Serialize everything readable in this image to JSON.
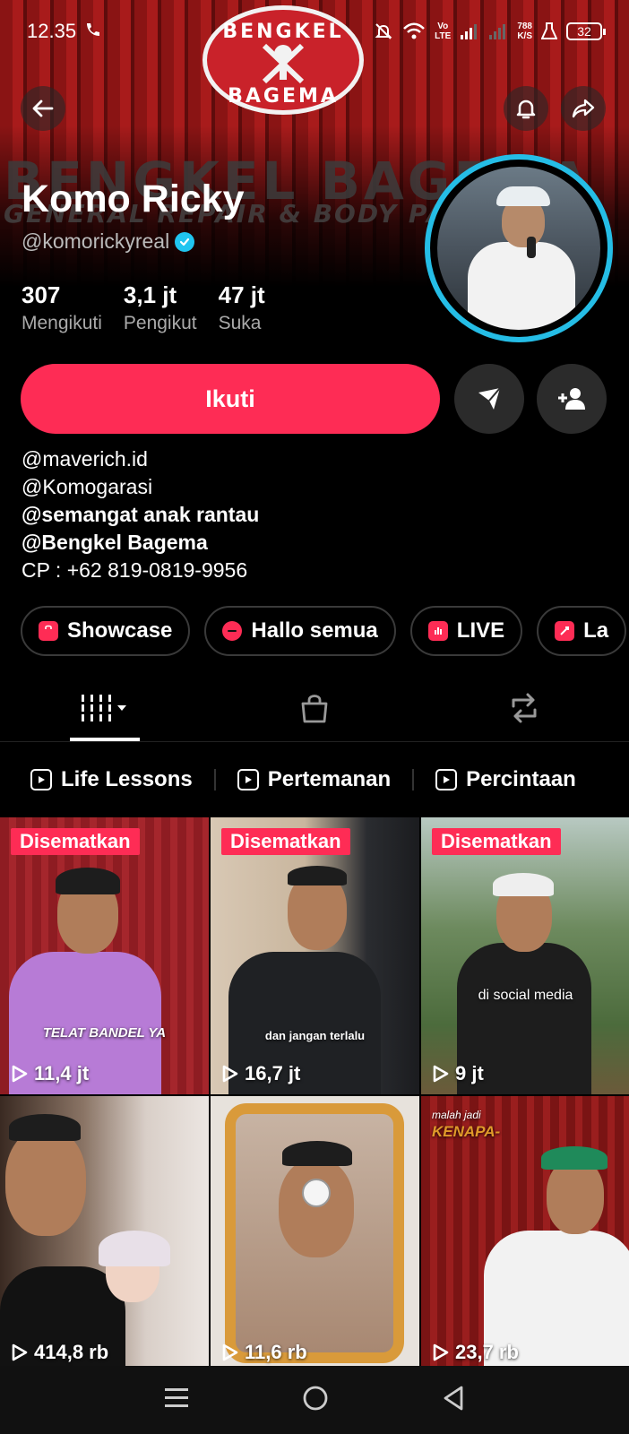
{
  "status_bar": {
    "time": "12.35",
    "network_speed_top": "788",
    "network_speed_bottom": "K/S",
    "battery": "32",
    "network_type_top": "Vo",
    "network_type_bottom": "LTE"
  },
  "banner": {
    "logo_top": "BENGKEL",
    "logo_bottom": "BAGEMA",
    "sign_text": "BENGKEL BAGEMA",
    "sign_sub": "GENERAL REPAIR & BODY PA"
  },
  "profile": {
    "display_name": "Komo Ricky",
    "username": "@komorickyreal",
    "stats": [
      {
        "value": "307",
        "label": "Mengikuti"
      },
      {
        "value": "3,1 jt",
        "label": "Pengikut"
      },
      {
        "value": "47 jt",
        "label": "Suka"
      }
    ],
    "follow_label": "Ikuti",
    "accent": "#fe2c55",
    "ring_color": "#25bde6"
  },
  "bio": [
    "@maverich.id",
    "@Komogarasi",
    "@semangat anak rantau",
    "@Bengkel Bagema",
    "CP : +62 819-0819-9956"
  ],
  "chips": [
    {
      "label": "Showcase",
      "icon": "shopping-bag-icon",
      "color": "#fe2c55"
    },
    {
      "label": "Hallo semua",
      "icon": "chat-bubble-icon",
      "color": "#fe2c55"
    },
    {
      "label": "LIVE",
      "icon": "live-icon",
      "color": "#fe2c55"
    },
    {
      "label": "La",
      "icon": "rocket-icon",
      "color": "#fe2c55"
    }
  ],
  "playlists": [
    "Life Lessons",
    "Pertemanan",
    "Percintaan"
  ],
  "videos": [
    {
      "views": "11,4 jt",
      "pinned": "Disematkan",
      "caption": "TELAT BANDEL YA"
    },
    {
      "views": "16,7 jt",
      "pinned": "Disematkan",
      "caption": "dan jangan terlalu"
    },
    {
      "views": "9 jt",
      "pinned": "Disematkan",
      "caption": "di social media"
    },
    {
      "views": "414,8 rb",
      "pinned": "",
      "caption": ""
    },
    {
      "views": "11,6 rb",
      "pinned": "",
      "caption": ""
    },
    {
      "views": "23,7 rb",
      "pinned": "",
      "caption_top": "malah jadi",
      "caption_big": "KENAPA-"
    }
  ]
}
